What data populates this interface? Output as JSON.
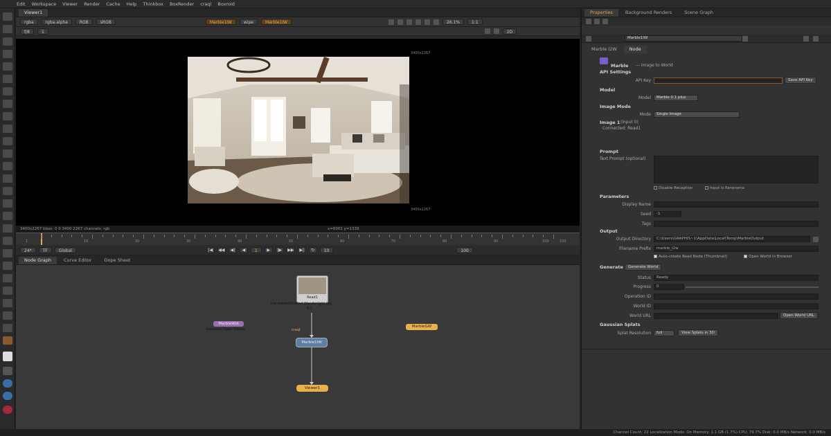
{
  "menubar": [
    "Edit",
    "Workspace",
    "Viewer",
    "Render",
    "Cache",
    "Help",
    "Thinkbox",
    "BoxRender",
    "craql",
    "Boxroid"
  ],
  "viewer": {
    "tab": "Viewer1",
    "channels": "rgba",
    "alpha": "rgba.alpha",
    "colorspace": "RGB",
    "display": "sRGB",
    "input_a": "Marble1IW",
    "wipe": "wipe",
    "input_b": "Marble1IW",
    "zoom": "26.1%",
    "ratio": "1:1",
    "mode": "2D",
    "frame_left": "f/8",
    "frame_num": "1",
    "format_tl": "3400x2267",
    "format_br": "3400x2267",
    "info_left": "3400x2267  bbox: 0 0 3400 2267 channels: rgb",
    "info_center": "x=6001 y=1339"
  },
  "timeline": {
    "start": "1",
    "end": "100",
    "ticks": [
      "10",
      "20",
      "30",
      "40",
      "50",
      "60",
      "70",
      "80",
      "90",
      "100"
    ],
    "fps": "24*",
    "tf": "TF",
    "scope": "Global",
    "current_frame": "1",
    "step": "10",
    "end_field": "100"
  },
  "nodegraph": {
    "tabs": [
      "Node Graph",
      "Curve Editor",
      "Dope Sheet"
    ],
    "nodes": {
      "read": "Read1",
      "read_path": "the hotels/Untitled-Wanderlight.jpg",
      "read_frames": "1-1",
      "marble": "Marble1IW",
      "viewer": "Viewer1",
      "left_node": "MarbleWld",
      "left_sub": "Gaussian Splat Viewer",
      "right_node": "MarbleGW",
      "marble_label": "craqt"
    }
  },
  "properties": {
    "tabs": [
      "Properties",
      "Background Renders",
      "Scene Graph"
    ],
    "node_name": "Marble1IW",
    "subtabs": [
      "Marble I2W",
      "Node"
    ],
    "header_title": "Marble",
    "header_sub": "— Image to World",
    "sections": {
      "api": "API Settings",
      "model": "Model",
      "image_mode": "Image Mode",
      "image1": "Image 1",
      "image1_suffix": "(input 0)",
      "prompt": "Prompt",
      "parameters": "Parameters",
      "output": "Output",
      "generate": "Generate",
      "gaussian": "Gaussian Splats"
    },
    "labels": {
      "api_key": "API Key",
      "model": "Model",
      "mode": "Mode",
      "text_prompt": "Text Prompt (optional)",
      "display_name": "Display Name",
      "seed": "Seed",
      "tags": "Tags",
      "output_dir": "Output Directory",
      "filename_prefix": "Filename Prefix",
      "status": "Status",
      "progress": "Progress",
      "operation_id": "Operation ID",
      "world_id": "World ID",
      "world_url": "World URL",
      "splat_res": "Splat Resolution"
    },
    "values": {
      "api_key": "",
      "model": "Marble 0.1 plus",
      "mode": "Single Image",
      "connected": "Connected: Read1",
      "seed": "-1",
      "output_dir": "C:\\Users\\GRAPHIS~1\\AppData\\Local\\Temp\\MarbleOutput",
      "filename_prefix": "marble_i2w",
      "status": "Ready",
      "progress": "0",
      "splat_res": "full"
    },
    "buttons": {
      "save_api_key": "Save API Key",
      "generate_world": "Generate World",
      "open_world_url": "Open World URL",
      "view_splats": "View Splats in 3D"
    },
    "checks": {
      "disable_recaption": "Disable Recaption",
      "input_panorama": "Input is Panorama",
      "auto_read": "Auto-create Read Node (Thumbnail)",
      "open_browser": "Open World in Browser"
    }
  },
  "statusbar": "Channel Count: 22  Localization Mode: On  Memory: 1.1 GB (1.7%)  CPU: 79.7%  Disk: 0.0 MB/s  Network: 0.0 MB/s",
  "colors": {
    "accent_orange": "#e6a94d",
    "node_blue": "#5c7fa3",
    "node_viewer": "#e8b14a",
    "node_purple": "#9a6fb0"
  }
}
